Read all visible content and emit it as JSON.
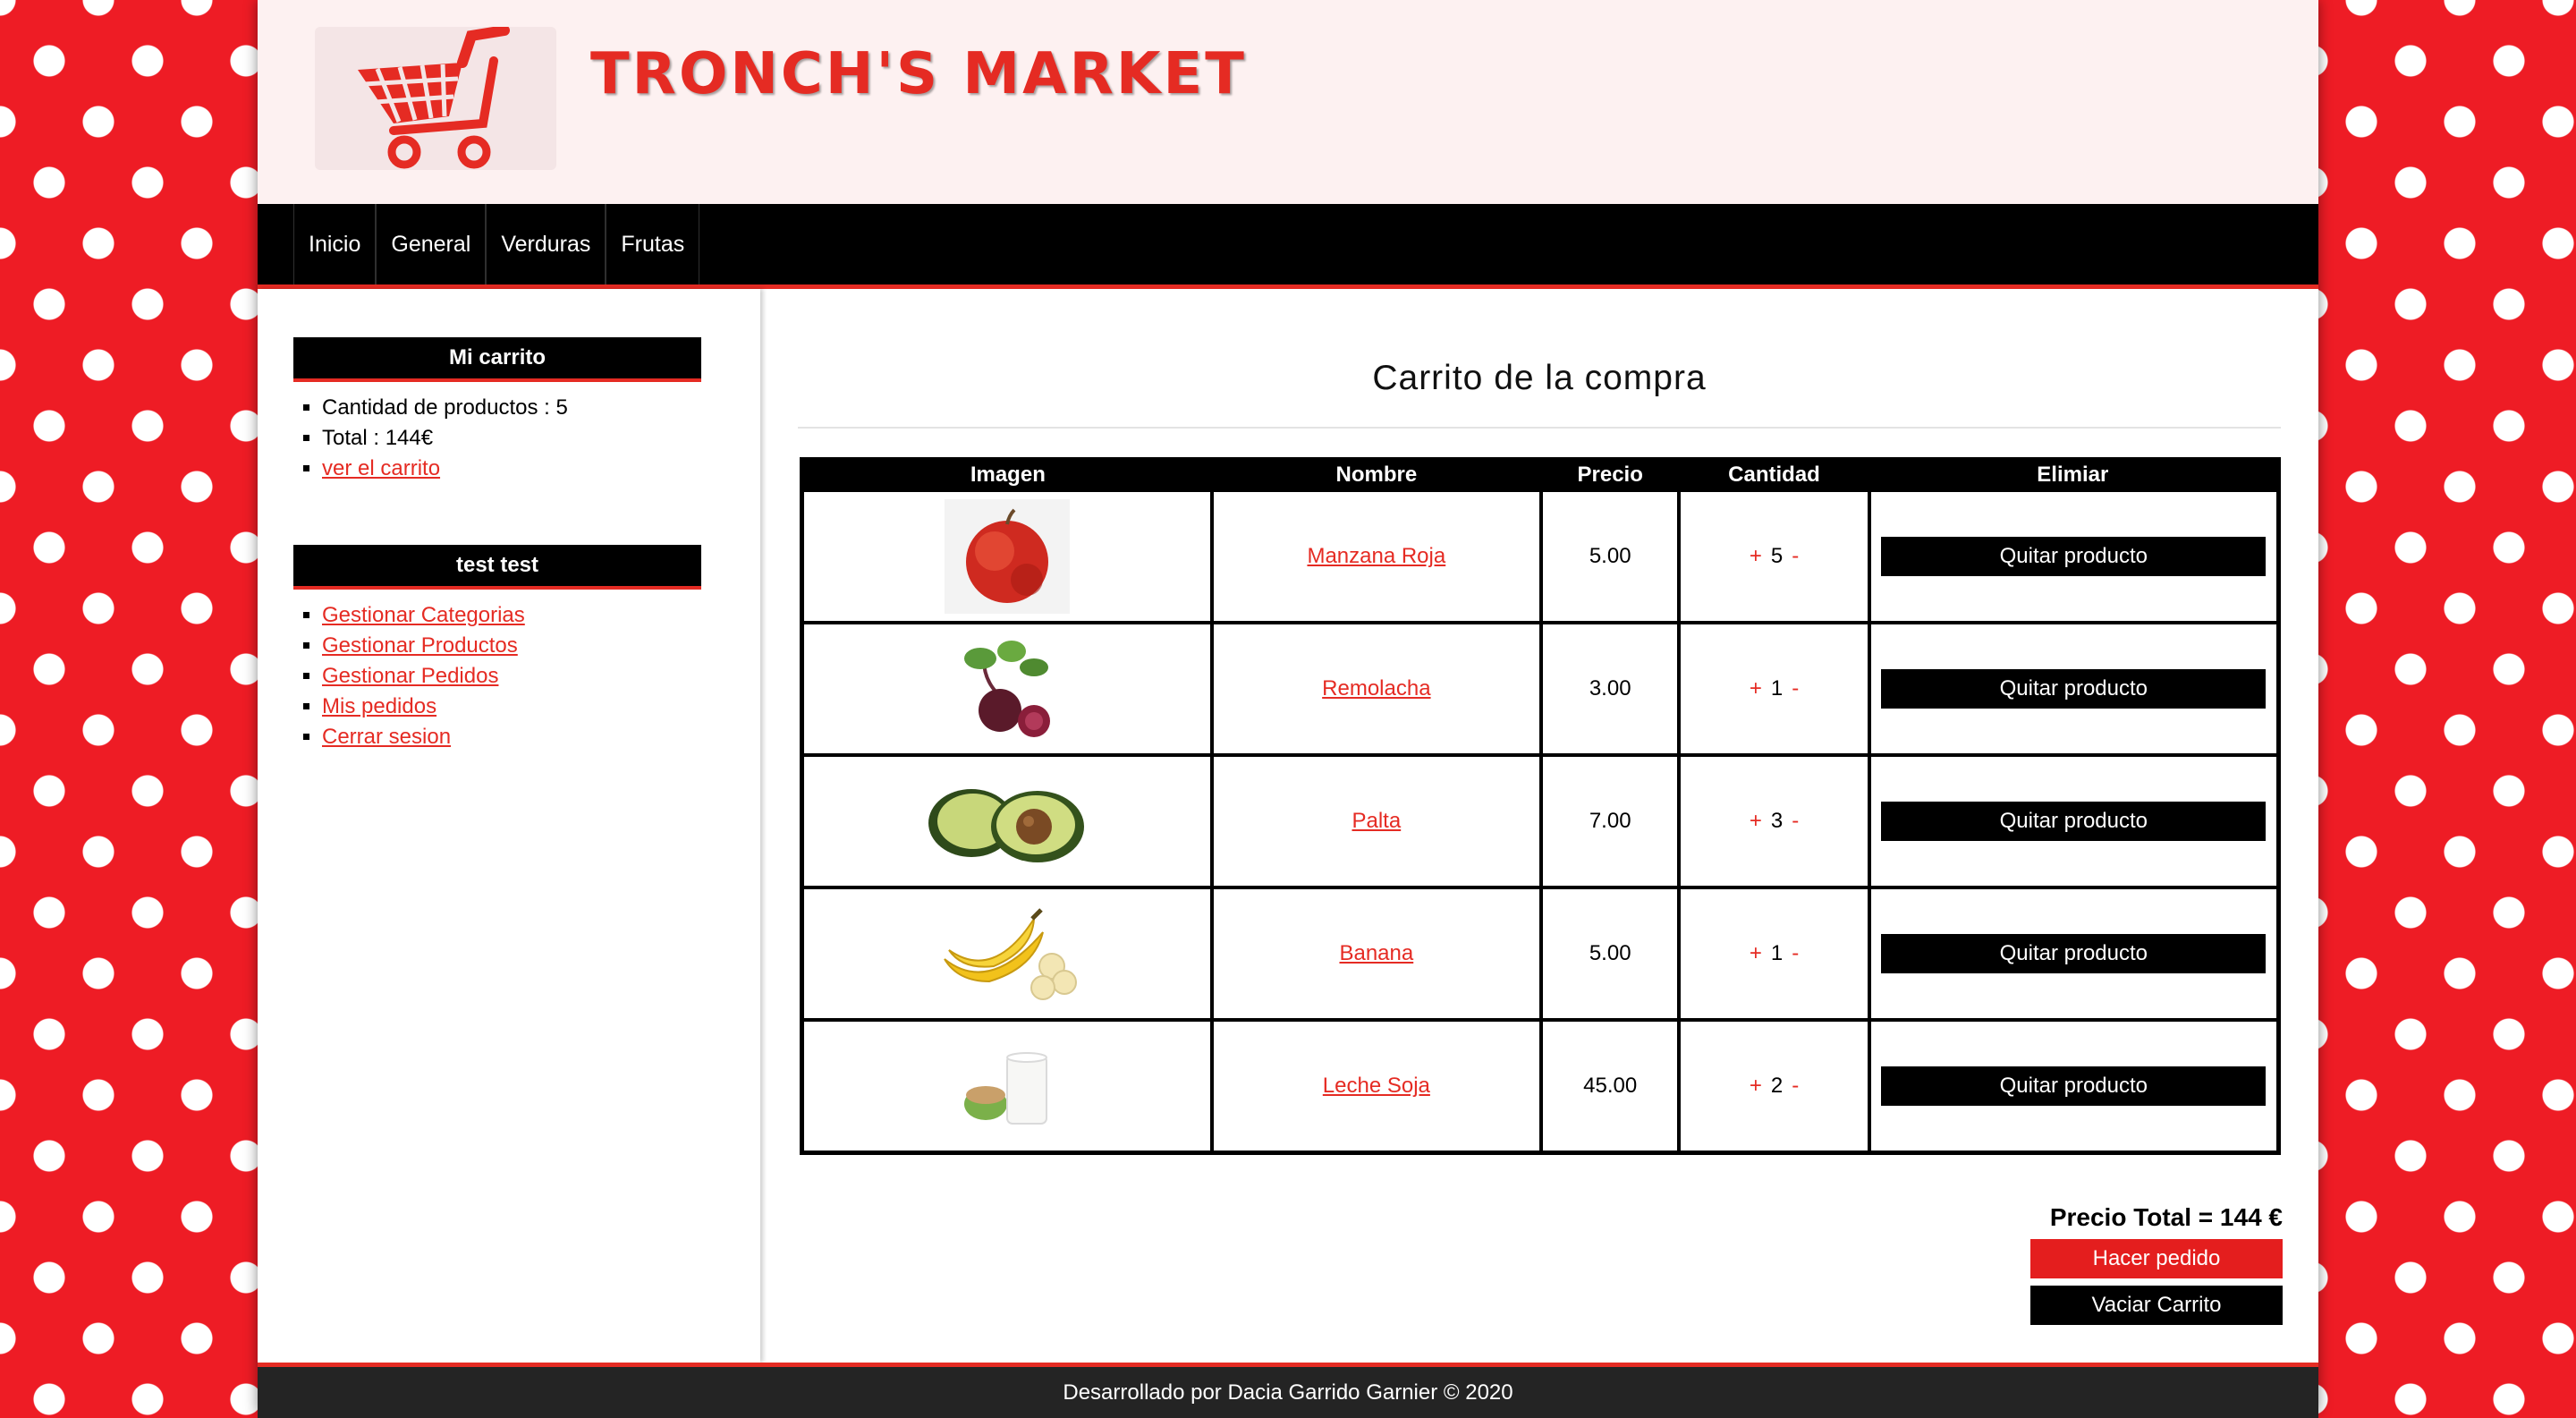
{
  "header": {
    "title": "TRONCH'S MARKET",
    "logo_icon": "shopping-cart-icon",
    "brand_color": "#e52b23"
  },
  "nav": {
    "items": [
      "Inicio",
      "General",
      "Verduras",
      "Frutas"
    ]
  },
  "sidebar": {
    "cart": {
      "heading": "Mi carrito",
      "quantity": "Cantidad de productos : 5",
      "total": "Total : 144€",
      "view_link": "ver el carrito"
    },
    "user": {
      "heading": "test test",
      "links": [
        "Gestionar Categorias",
        "Gestionar Productos",
        "Gestionar Pedidos",
        "Mis pedidos",
        "Cerrar sesion"
      ]
    }
  },
  "main": {
    "title": "Carrito de la compra",
    "table": {
      "headers": [
        "Imagen",
        "Nombre",
        "Precio",
        "Cantidad",
        "Elimiar"
      ],
      "rows": [
        {
          "image": "apple-image",
          "name": "Manzana Roja",
          "price": "5.00",
          "qty": "5",
          "plus": "+",
          "minus": "-",
          "remove": "Quitar producto"
        },
        {
          "image": "beet-image",
          "name": "Remolacha",
          "price": "3.00",
          "qty": "1",
          "plus": "+",
          "minus": "-",
          "remove": "Quitar producto"
        },
        {
          "image": "avocado-image",
          "name": "Palta",
          "price": "7.00",
          "qty": "3",
          "plus": "+",
          "minus": "-",
          "remove": "Quitar producto"
        },
        {
          "image": "banana-image",
          "name": "Banana",
          "price": "5.00",
          "qty": "1",
          "plus": "+",
          "minus": "-",
          "remove": "Quitar producto"
        },
        {
          "image": "soy-milk-image",
          "name": "Leche Soja",
          "price": "45.00",
          "qty": "2",
          "plus": "+",
          "minus": "-",
          "remove": "Quitar producto"
        }
      ]
    },
    "summary": {
      "total": "Precio Total = 144 €",
      "order_button": "Hacer pedido",
      "empty_button": "Vaciar Carrito"
    }
  },
  "footer": {
    "text": "Desarrollado por Dacia Garrido Garnier © 2020"
  }
}
